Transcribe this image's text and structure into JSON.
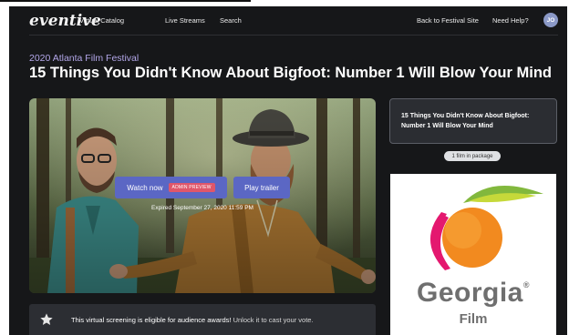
{
  "nav": {
    "brand": "eventive",
    "links": [
      "Virtual Catalog",
      "Live Streams",
      "Search"
    ],
    "right_links": [
      "Back to Festival Site",
      "Need Help?"
    ],
    "avatar_initials": "JO"
  },
  "event": {
    "festival": "2020 Atlanta Film Festival",
    "title": "15 Things You Didn't Know About Bigfoot: Number 1 Will Blow Your Mind"
  },
  "hero": {
    "watch_label": "Watch now",
    "admin_badge": "ADMIN PREVIEW",
    "trailer_label": "Play trailer",
    "expired_text": "Expired September 27, 2020 11:59 PM"
  },
  "awards": {
    "icon": "star-icon",
    "strong_text": "This virtual screening is eligible for audience awards!",
    "rest_text": " Unlock it to cast your vote."
  },
  "package": {
    "title": "15 Things You Didn't Know About Bigfoot: Number 1 Will Blow Your Mind",
    "count_label": "1 film in package"
  },
  "sponsor": {
    "name": "Georgia",
    "registered": "®",
    "sub": "Film"
  },
  "colors": {
    "background": "#161719",
    "accent_button": "#5b67c4",
    "admin_badge": "#e0566a",
    "festival_text": "#b3a7e9"
  }
}
